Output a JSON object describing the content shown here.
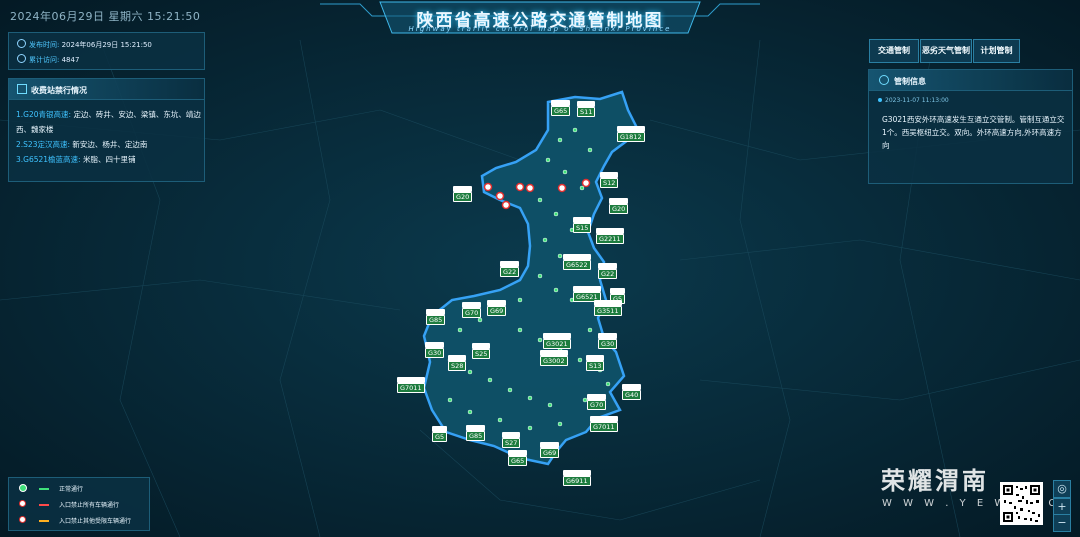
{
  "header": {
    "datetime": "2024年06月29日 星期六 15:21:50",
    "title": "陕西省高速公路交通管制地图",
    "subtitle": "Highway traffic control map of Shaanxi Province"
  },
  "info": {
    "publish_label": "发布时间:",
    "publish_value": "2024年06月29日 15:21:50",
    "visits_label": "累计访问:",
    "visits_value": "4847"
  },
  "toll_panel": {
    "title": "收费站禁行情况",
    "items": [
      {
        "road": "1.G20青银高速:",
        "text": "定边、砖井、安边、梁镇、东坑、靖边"
      },
      {
        "road": "",
        "text": "西、魏家楼"
      },
      {
        "road": "2.S23定汉高速:",
        "text": "新安边、杨井、定边南"
      },
      {
        "road": "3.G6521榆蓝高速:",
        "text": "米脂、四十里铺"
      }
    ]
  },
  "buttons": {
    "traffic": "交通管制",
    "weather": "恶劣天气管制",
    "plan": "计划管制"
  },
  "control_info": {
    "title": "管制信息",
    "time": "2023-11-07 11:13:00",
    "text": "G3021西安外环高速发生互通立交管制。管制互通立交1个。西吴枢纽立交。双向。外环高速方向,外环高速方向"
  },
  "legend": {
    "items": [
      {
        "label": "正常通行",
        "icon_color": "#3fe07a",
        "line_color": "#3fe07a"
      },
      {
        "label": "入口禁止所有车辆通行",
        "icon_color": "#ffffff",
        "line_color": "#ff4a4a"
      },
      {
        "label": "入口禁止其他受限车辆通行",
        "icon_color": "#ffffff",
        "line_color": "#ffb020"
      }
    ]
  },
  "shields": [
    {
      "top": "",
      "code": "G65"
    },
    {
      "top": "",
      "code": "S11"
    },
    {
      "top": "",
      "code": "G1812"
    },
    {
      "top": "",
      "code": "G20"
    },
    {
      "top": "",
      "code": "S12"
    },
    {
      "top": "",
      "code": "G20"
    },
    {
      "top": "",
      "code": "S15"
    },
    {
      "top": "",
      "code": "G2211"
    },
    {
      "top": "",
      "code": "G22"
    },
    {
      "top": "",
      "code": "G6522"
    },
    {
      "top": "",
      "code": "G22"
    },
    {
      "top": "",
      "code": "G6521"
    },
    {
      "top": "",
      "code": "G5"
    },
    {
      "top": "",
      "code": "G3511"
    },
    {
      "top": "",
      "code": "G85"
    },
    {
      "top": "",
      "code": "G70"
    },
    {
      "top": "",
      "code": "G69"
    },
    {
      "top": "",
      "code": "G30"
    },
    {
      "top": "",
      "code": "S25"
    },
    {
      "top": "",
      "code": "G3021"
    },
    {
      "top": "",
      "code": "G30"
    },
    {
      "top": "",
      "code": "S28"
    },
    {
      "top": "",
      "code": "G3002"
    },
    {
      "top": "",
      "code": "S13"
    },
    {
      "top": "",
      "code": "G7011"
    },
    {
      "top": "",
      "code": "G40"
    },
    {
      "top": "",
      "code": "G70"
    },
    {
      "top": "",
      "code": "G7011"
    },
    {
      "top": "",
      "code": "G5"
    },
    {
      "top": "",
      "code": "G85"
    },
    {
      "top": "",
      "code": "S27"
    },
    {
      "top": "",
      "code": "G69"
    },
    {
      "top": "",
      "code": "G65"
    },
    {
      "top": "",
      "code": "G6911"
    }
  ],
  "watermark": {
    "name": "荣耀渭南",
    "url": "W W W . Y E W N . C"
  },
  "zoom": {
    "locate": "◎",
    "in": "+",
    "out": "−"
  }
}
